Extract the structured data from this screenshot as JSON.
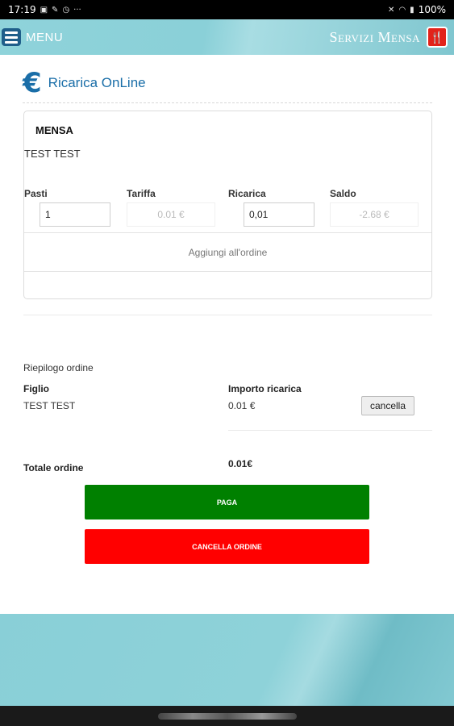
{
  "status_bar": {
    "time": "17:19",
    "battery": "100%"
  },
  "topbar": {
    "menu_label": "MENU",
    "app_title": "Servizi Mensa"
  },
  "page": {
    "title": "Ricarica OnLine"
  },
  "card": {
    "title": "MENSA",
    "child_name": "TEST TEST",
    "columns": {
      "pasti": "Pasti",
      "tariffa": "Tariffa",
      "ricarica": "Ricarica",
      "saldo": "Saldo"
    },
    "values": {
      "pasti": "1",
      "tariffa": "0.01 €",
      "ricarica": "0,01",
      "saldo": "-2.68 €"
    },
    "add_button": "Aggiungi all'ordine"
  },
  "summary": {
    "title": "Riepilogo ordine",
    "figlio_label": "Figlio",
    "importo_label": "Importo ricarica",
    "figlio_value": "TEST TEST",
    "importo_value": "0.01 €",
    "cancel_label": "cancella",
    "total_label": "Totale ordine",
    "total_value": "0.01€"
  },
  "actions": {
    "pay": "PAGA",
    "cancel_order": "CANCELLA ORDINE"
  },
  "colors": {
    "accent": "#1a6ea8",
    "pay": "#008000",
    "cancel": "#ff0000",
    "header": "#8fd3da"
  }
}
